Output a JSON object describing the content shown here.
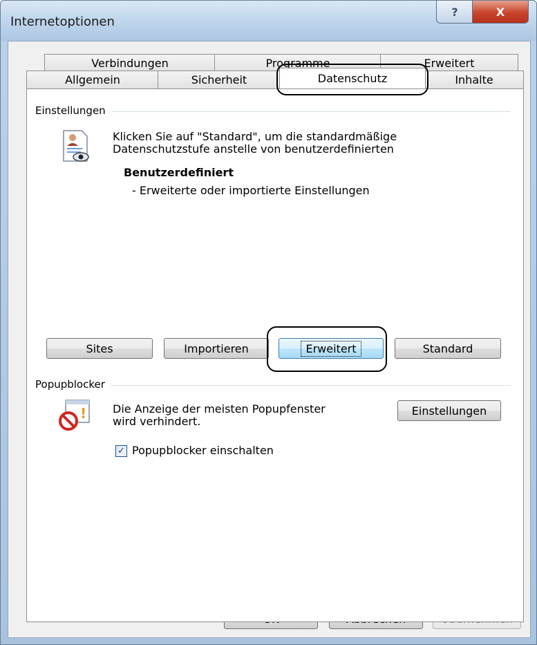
{
  "window": {
    "title": "Internetoptionen",
    "help_glyph": "?",
    "close_glyph": "X"
  },
  "tabs": {
    "row_back": [
      "Verbindungen",
      "Programme",
      "Erweitert"
    ],
    "row_front": [
      "Allgemein",
      "Sicherheit",
      "Datenschutz",
      "Inhalte"
    ],
    "active": "Datenschutz"
  },
  "settings": {
    "group_title": "Einstellungen",
    "description_line1": "Klicken Sie auf \"Standard\", um die standardmäßige",
    "description_line2": "Datenschutzstufe anstelle von benutzerdefinierten",
    "level_title": "Benutzerdefiniert",
    "level_detail": "- Erweiterte oder importierte Einstellungen",
    "buttons": {
      "sites": "Sites",
      "import": "Importieren",
      "advanced": "Erweitert",
      "default": "Standard"
    }
  },
  "popup": {
    "group_title": "Popupblocker",
    "description_line1": "Die Anzeige der meisten Popupfenster",
    "description_line2": "wird verhindert.",
    "settings_button": "Einstellungen",
    "checkbox_label": "Popupblocker einschalten",
    "checkbox_checked": true
  },
  "footer": {
    "ok": "OK",
    "cancel": "Abbrechen",
    "apply": "Übernehmen"
  }
}
